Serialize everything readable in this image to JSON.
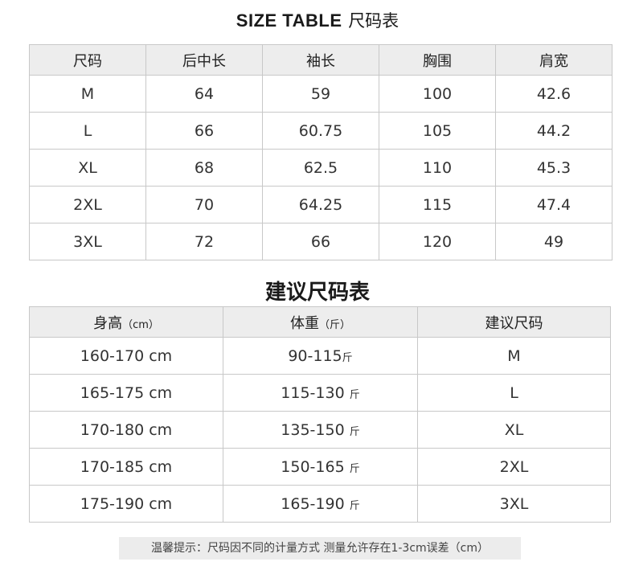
{
  "title1": {
    "en": "SIZE TABLE",
    "cn": "尺码表"
  },
  "size_table": {
    "headers": [
      "尺码",
      "后中长",
      "袖长",
      "胸围",
      "肩宽"
    ],
    "rows": [
      [
        "M",
        "64",
        "59",
        "100",
        "42.6"
      ],
      [
        "L",
        "66",
        "60.75",
        "105",
        "44.2"
      ],
      [
        "XL",
        "68",
        "62.5",
        "110",
        "45.3"
      ],
      [
        "2XL",
        "70",
        "64.25",
        "115",
        "47.4"
      ],
      [
        "3XL",
        "72",
        "66",
        "120",
        "49"
      ]
    ]
  },
  "title2": "建议尺码表",
  "suggest_table": {
    "headers": [
      {
        "main": "身高",
        "unit": "（cm）"
      },
      {
        "main": "体重",
        "unit": "（斤）"
      },
      {
        "main": "建议尺码",
        "unit": ""
      }
    ],
    "rows": [
      {
        "height": "160-170 cm",
        "weight": "90-115",
        "weight_unit": "斤",
        "size": "M"
      },
      {
        "height": "165-175 cm",
        "weight": "115-130 ",
        "weight_unit": "斤",
        "size": "L"
      },
      {
        "height": "170-180 cm",
        "weight": "135-150 ",
        "weight_unit": "斤",
        "size": "XL"
      },
      {
        "height": "170-185 cm",
        "weight": "150-165 ",
        "weight_unit": "斤",
        "size": "2XL"
      },
      {
        "height": "175-190 cm",
        "weight": "165-190 ",
        "weight_unit": "斤",
        "size": "3XL"
      }
    ]
  },
  "note": "温馨提示：尺码因不同的计量方式 测量允许存在1-3cm误差（cm）"
}
